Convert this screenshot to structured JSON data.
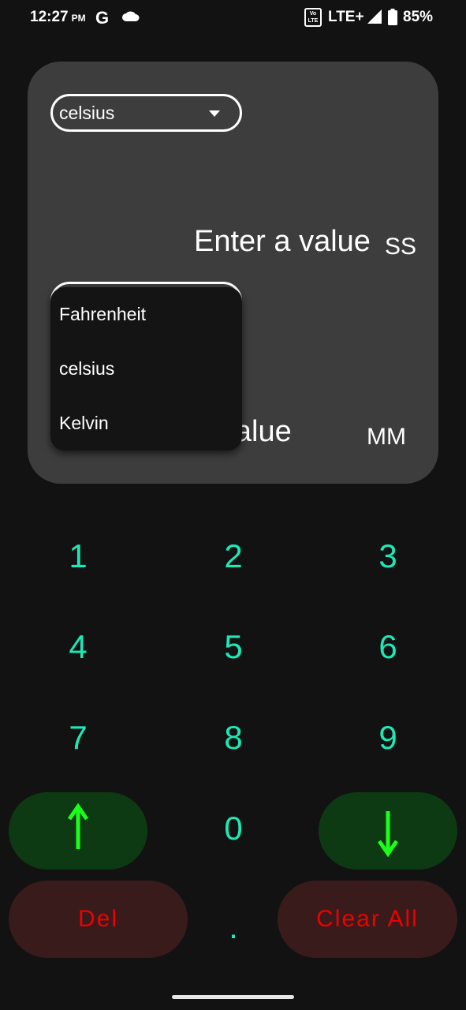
{
  "status_bar": {
    "time": "12:27",
    "ampm": "PM",
    "network": "LTE+",
    "volte": "Vo LTE",
    "battery": "85%"
  },
  "converter": {
    "top_select_value": "celsius",
    "input_label_1": "Enter a value",
    "unit_abbr_1": "SS",
    "input_label_2": "r a value",
    "unit_abbr_2": "MM"
  },
  "dropdown": {
    "options": [
      "Fahrenheit",
      "celsius",
      "Kelvin"
    ]
  },
  "keypad": {
    "keys": [
      "1",
      "2",
      "3",
      "4",
      "5",
      "6",
      "7",
      "8",
      "9",
      "0",
      "."
    ],
    "del_label": "Del",
    "clear_label": "Clear All"
  },
  "colors": {
    "digit": "#1de9b6",
    "arrow": "#1aff1a",
    "danger_text": "#e00000",
    "card_bg": "#3d3d3d"
  }
}
